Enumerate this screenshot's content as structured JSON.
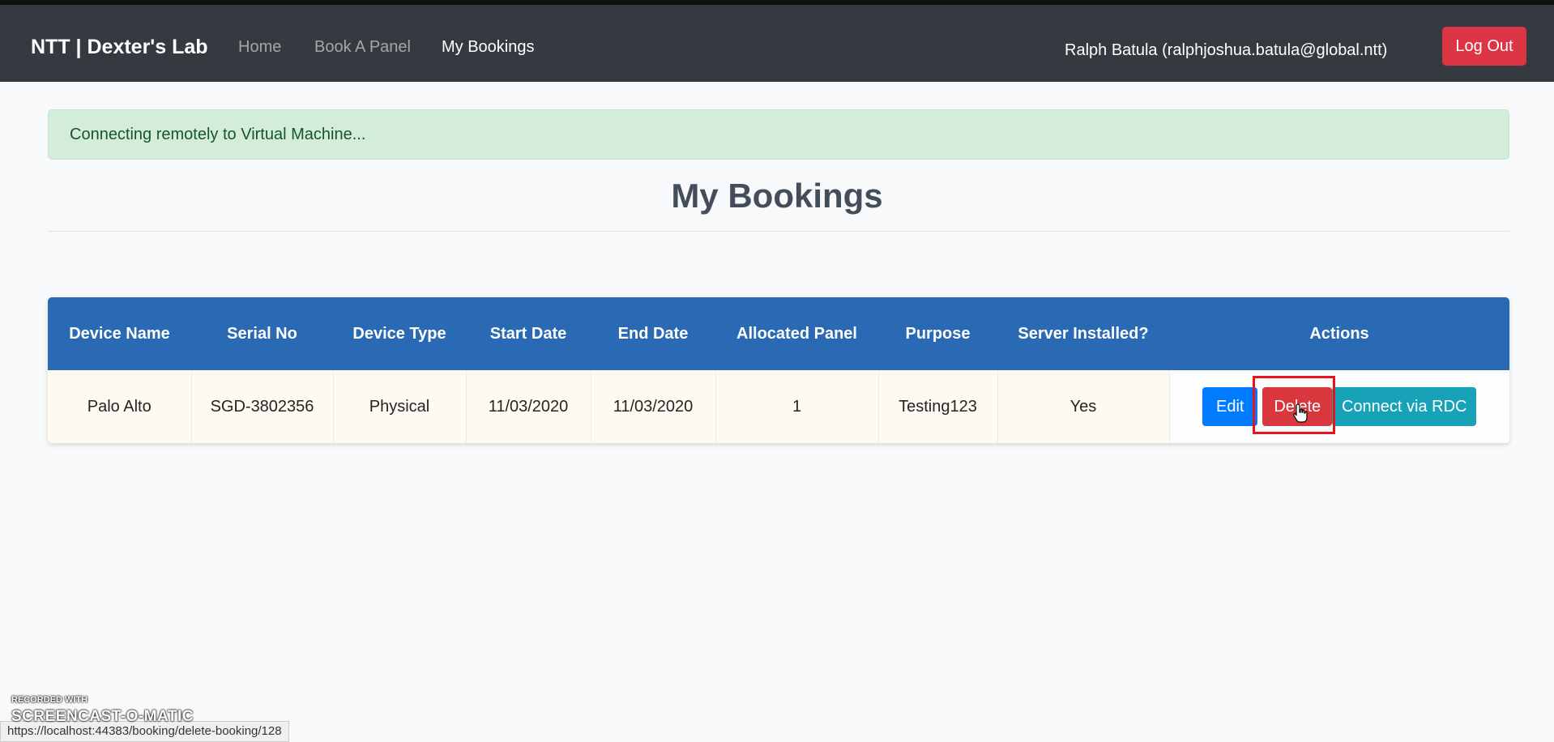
{
  "navbar": {
    "brand": "NTT | Dexter's Lab",
    "links": [
      {
        "label": "Home"
      },
      {
        "label": "Book A Panel"
      },
      {
        "label": "My Bookings"
      }
    ],
    "user": "Ralph Batula (ralphjoshua.batula@global.ntt)",
    "logout_label": "Log Out"
  },
  "alert": {
    "message": "Connecting remotely to Virtual Machine..."
  },
  "page": {
    "title": "My Bookings"
  },
  "table": {
    "headers": [
      "Device Name",
      "Serial No",
      "Device Type",
      "Start Date",
      "End Date",
      "Allocated Panel",
      "Purpose",
      "Server Installed?",
      "Actions"
    ],
    "rows": [
      {
        "device_name": "Palo Alto",
        "serial_no": "SGD-3802356",
        "device_type": "Physical",
        "start_date": "11/03/2020",
        "end_date": "11/03/2020",
        "allocated_panel": "1",
        "purpose": "Testing123",
        "server_installed": "Yes",
        "actions": {
          "edit_label": "Edit",
          "delete_label": "Delete",
          "rdc_label": "Connect via RDC"
        }
      }
    ]
  },
  "status_bar": {
    "url": "https://localhost:44383/booking/delete-booking/128"
  },
  "watermark": {
    "small": "RECORDED WITH",
    "big": "SCREENCAST-O-MATIC"
  },
  "colors": {
    "navbar": "#343a40",
    "table_header": "#2a6ab5",
    "danger": "#dc3545",
    "primary": "#007bff",
    "info": "#17a2b8",
    "alert_bg": "#d4edda"
  }
}
